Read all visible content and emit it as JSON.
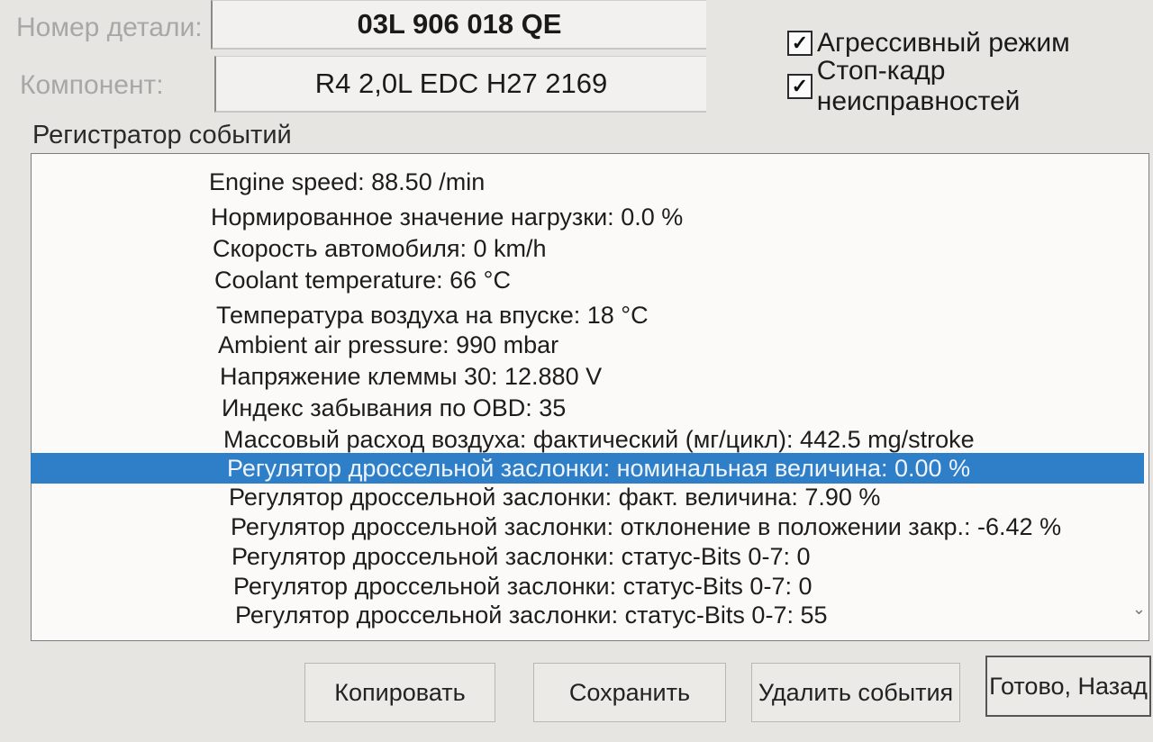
{
  "header": {
    "part_number_label": "Номер детали:",
    "part_number_value": "03L 906 018 QE",
    "component_label": "Компонент:",
    "component_value": "R4 2,0L EDC   H27 2169"
  },
  "options": {
    "aggressive_mode": {
      "label": "Агрессивный режим",
      "checked": true,
      "check_glyph": "✓"
    },
    "freeze_frame": {
      "label": "Стоп-кадр неисправностей",
      "checked": true,
      "check_glyph": "✓"
    }
  },
  "event_logger": {
    "title": "Регистратор событий",
    "selected_index": 9,
    "rows": [
      "Engine speed: 88.50 /min",
      "Нормированное значение нагрузки: 0.0 %",
      "Скорость автомобиля: 0 km/h",
      "Coolant temperature: 66 °C",
      "Температура воздуха на впуске: 18 °C",
      "Ambient air pressure: 990 mbar",
      "Напряжение клеммы 30: 12.880 V",
      "Индекс забывания по OBD: 35",
      "Массовый расход воздуха: фактический (мг/цикл): 442.5 mg/stroke",
      "Регулятор дроссельной заслонки: номинальная величина: 0.00 %",
      "Регулятор дроссельной заслонки: факт. величина: 7.90 %",
      "Регулятор дроссельной заслонки: отклонение в положении закр.: -6.42 %",
      "Регулятор дроссельной заслонки: статус-Bits 0-7: 0",
      "Регулятор дроссельной заслонки: статус-Bits 0-7: 0",
      "Регулятор дроссельной заслонки: статус-Bits 0-7: 55"
    ],
    "scroll_down_glyph": "⌄"
  },
  "buttons": {
    "copy": "Копировать",
    "save": "Сохранить",
    "delete_events": "Удалить события",
    "done_back": "Готово, Назад"
  },
  "colors": {
    "selection": "#2f7fc8",
    "background": "#e7e5e2",
    "list_background": "#fbfaf8"
  }
}
